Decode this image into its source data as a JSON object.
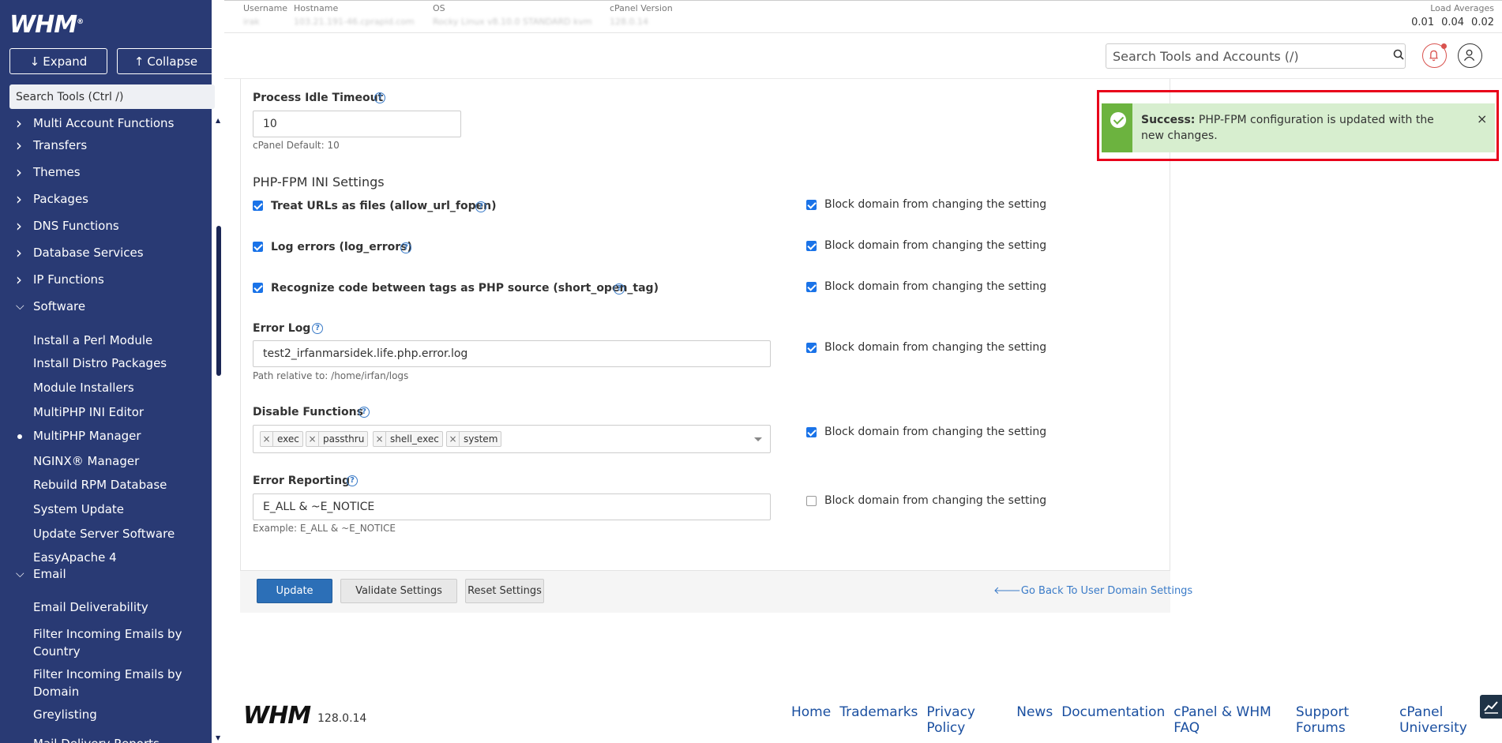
{
  "sidebar": {
    "logo": "WHM",
    "expand_label": "Expand",
    "collapse_label": "Collapse",
    "search_placeholder": "Search Tools (Ctrl /)",
    "categories": [
      {
        "label": "Multi Account Functions",
        "expanded": false
      },
      {
        "label": "Transfers",
        "expanded": false
      },
      {
        "label": "Themes",
        "expanded": false
      },
      {
        "label": "Packages",
        "expanded": false
      },
      {
        "label": "DNS Functions",
        "expanded": false
      },
      {
        "label": "Database Services",
        "expanded": false
      },
      {
        "label": "IP Functions",
        "expanded": false
      },
      {
        "label": "Software",
        "expanded": true
      },
      {
        "label": "Email",
        "expanded": true
      }
    ],
    "software_items": [
      "Install a Perl Module",
      "Install Distro Packages",
      "Module Installers",
      "MultiPHP INI Editor",
      "MultiPHP Manager",
      "NGINX® Manager",
      "Rebuild RPM Database",
      "System Update",
      "Update Server Software",
      "EasyApache 4"
    ],
    "active_item": "MultiPHP Manager",
    "email_items": [
      "Email Deliverability",
      "Filter Incoming Emails by Country",
      "Filter Incoming Emails by Domain",
      "Greylisting",
      "Mail Delivery Reports"
    ]
  },
  "topbar": {
    "username_label": "Username",
    "username_value": "irak",
    "hostname_label": "Hostname",
    "hostname_value": "103.21.191-46.cprapid.com",
    "os_label": "OS",
    "os_value": "Rocky Linux v8.10.0 STANDARD kvm",
    "cpanel_version_label": "cPanel Version",
    "cpanel_version_value": "128.0.14",
    "load_averages_label": "Load Averages",
    "load_averages": [
      "0.01",
      "0.04",
      "0.02"
    ]
  },
  "header": {
    "search_placeholder": "Search Tools and Accounts (/)"
  },
  "form": {
    "process_idle_timeout_label": "Process Idle Timeout",
    "process_idle_timeout_value": "10",
    "process_idle_timeout_hint": "cPanel Default: 10",
    "ini_section_title": "PHP-FPM INI Settings",
    "block_label": "Block domain from changing the setting",
    "settings": [
      {
        "label": "Treat URLs as files (allow_url_fopen)",
        "checked": true,
        "block_checked": true
      },
      {
        "label": "Log errors (log_errors)",
        "checked": true,
        "block_checked": true
      },
      {
        "label": "Recognize code between tags as PHP source (short_open_tag)",
        "checked": true,
        "block_checked": true
      }
    ],
    "error_log_label": "Error Log",
    "error_log_value": "test2_irfanmarsidek.life.php.error.log",
    "error_log_hint": "Path relative to: /home/irfan/logs",
    "error_log_block_checked": true,
    "disable_functions_label": "Disable Functions",
    "disable_functions": [
      "exec",
      "passthru",
      "shell_exec",
      "system"
    ],
    "disable_functions_block_checked": true,
    "error_reporting_label": "Error Reporting",
    "error_reporting_value": "E_ALL & ~E_NOTICE",
    "error_reporting_hint": "Example: E_ALL & ~E_NOTICE",
    "error_reporting_block_checked": false
  },
  "actions": {
    "update_label": "Update",
    "validate_label": "Validate Settings",
    "reset_label": "Reset Settings",
    "back_link": "Go Back To User Domain Settings"
  },
  "alert": {
    "title": "Success:",
    "message": "PHP-FPM configuration is updated with the new changes.",
    "close": "×"
  },
  "footer": {
    "logo": "WHM",
    "version": "128.0.14",
    "links": [
      "Home",
      "Trademarks",
      "Privacy Policy",
      "News",
      "Documentation",
      "cPanel & WHM FAQ",
      "Support Forums",
      "cPanel University"
    ]
  },
  "colors": {
    "sidebar_bg": "#293a74",
    "primary_button": "#2c6fb7",
    "success_bg": "#d7eecf",
    "success_accent": "#6cb33f",
    "highlight_frame": "#e8001a"
  }
}
